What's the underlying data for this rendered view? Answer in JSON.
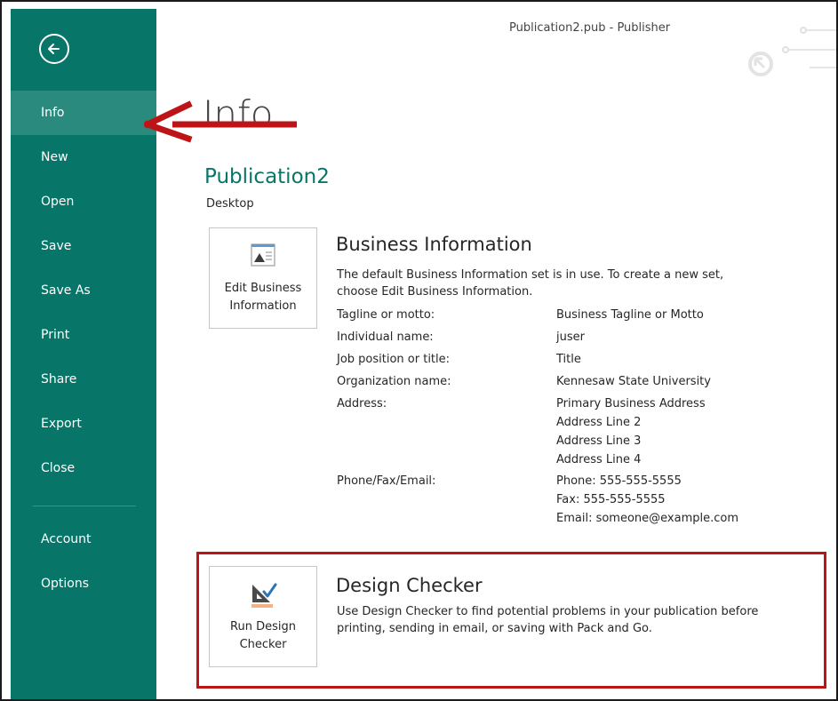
{
  "window": {
    "title": "Publication2.pub - Publisher"
  },
  "sidebar": {
    "back_label": "Back",
    "items": [
      {
        "id": "info",
        "label": "Info",
        "active": true
      },
      {
        "id": "new",
        "label": "New"
      },
      {
        "id": "open",
        "label": "Open"
      },
      {
        "id": "save",
        "label": "Save"
      },
      {
        "id": "save-as",
        "label": "Save As"
      },
      {
        "id": "print",
        "label": "Print"
      },
      {
        "id": "share",
        "label": "Share"
      },
      {
        "id": "export",
        "label": "Export"
      },
      {
        "id": "close",
        "label": "Close"
      }
    ],
    "bottom_items": [
      {
        "id": "account",
        "label": "Account"
      },
      {
        "id": "options",
        "label": "Options"
      }
    ]
  },
  "main": {
    "title": "Info",
    "document_name": "Publication2",
    "location": "Desktop",
    "business": {
      "tile_label": "Edit Business\nInformation",
      "title": "Business Information",
      "description": "The default Business Information set is in use. To create a new set, choose Edit Business Information.",
      "fields": [
        {
          "label": "Tagline or motto:",
          "value": "Business Tagline or Motto"
        },
        {
          "label": "Individual name:",
          "value": "juser"
        },
        {
          "label": "Job position or title:",
          "value": "Title"
        },
        {
          "label": "Organization name:",
          "value": "Kennesaw State University"
        },
        {
          "label": "Address:",
          "value": "Primary Business Address\nAddress Line 2\nAddress Line 3\nAddress Line 4"
        },
        {
          "label": "Phone/Fax/Email:",
          "value": "Phone: 555-555-5555\nFax: 555-555-5555\nEmail: someone@example.com"
        }
      ]
    },
    "design_checker": {
      "tile_label": "Run Design\nChecker",
      "title": "Design Checker",
      "description": "Use Design Checker to find potential problems in your publication before printing, sending in email, or saving with Pack and Go."
    }
  },
  "colors": {
    "sidebar_bg": "#077568",
    "sidebar_active": "#2b8a7e",
    "accent_text": "#077568",
    "annotation_red": "#bd1418"
  },
  "icons": [
    "back-arrow-icon",
    "business-info-icon",
    "design-checker-icon",
    "red-arrow-annotation"
  ]
}
